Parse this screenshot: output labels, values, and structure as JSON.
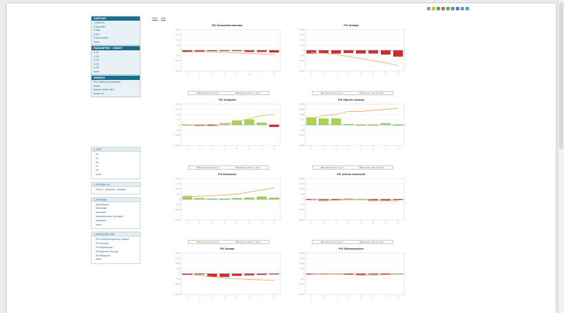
{
  "breadcrumb": [
    "stat",
    "ath"
  ],
  "sidebar": {
    "panels": [
      {
        "title": "SUPPORT",
        "items": [
          "1.Intensiv",
          "2.Spezifikt",
          "3.Test",
          "4.HEI",
          "5.Kennzahlen",
          "more"
        ]
      },
      {
        "title": "PARAMETER - CREDIT",
        "items": [
          "4_01",
          "4_02",
          "4_03",
          "4_04",
          "4_05",
          "more"
        ]
      },
      {
        "title": "MENGES",
        "items": [
          "PIV Liabilities prozentum",
          "Kredit",
          "Kapital anteil reg E",
          "Kredit Fin"
        ]
      }
    ],
    "filters": [
      {
        "title": "4_VISIT",
        "items": [
          "01",
          "02",
          "03",
          "04",
          "05",
          "more"
        ]
      },
      {
        "title": "4_SPICNAR_09",
        "items": [
          "201(2) : Schindler, Sanierer"
        ]
      },
      {
        "title": "4_SPEGAND",
        "items": [
          "Interfliessen",
          "Verkraege",
          "Anneigen",
          "Leistelekunden Anneigen",
          "Sanderes",
          "more"
        ]
      },
      {
        "title": "4_KATEGORIE_UNP",
        "items": [
          "PIV Umsatzsteigerung Gesamt",
          "PIV Umzugs",
          "PIV Ableitungen",
          "PIV Eigenes Umzugs",
          "PIV Retoumer",
          "more"
        ]
      }
    ]
  },
  "legend": {
    "series_a": "Kapital anteil reg E",
    "series_b": "Kapital anteil Fin reg E"
  },
  "colors": {
    "bar_neg": "#d42a2a",
    "bar_pos": "#a8d84a",
    "line": "#f0b070",
    "zero": "#5b8fa8",
    "panel_title": "#1a6b8f"
  },
  "chart_data": [
    {
      "type": "bar",
      "title": "PIV Kennzahlenumsatze",
      "ylim": [
        -2000,
        2000
      ],
      "yticks": [
        "2000",
        "1500",
        "1000",
        "500",
        "0",
        "-500",
        "-1000",
        "-2000"
      ],
      "xticks": [
        "1",
        "2",
        "3",
        "4",
        "5",
        "6",
        "7",
        "8"
      ],
      "series": [
        {
          "name": "Kapital anteil reg E",
          "values": [
            -150,
            -100,
            -50,
            -50,
            -50,
            -150,
            -150,
            -200
          ]
        },
        {
          "name": "Kapital anteil Fin reg E",
          "values": [
            -150,
            -150,
            -150,
            -200,
            -250,
            -300,
            -350,
            -400
          ]
        }
      ]
    },
    {
      "type": "bar",
      "title": "PIV Umlage",
      "ylim": [
        -2000,
        2000
      ],
      "yticks": [
        "2000",
        "1500",
        "1000",
        "500",
        "0",
        "-500",
        "-1000",
        "-2000"
      ],
      "xticks": [
        "1",
        "2",
        "3",
        "4",
        "5",
        "6",
        "7",
        "8"
      ],
      "series": [
        {
          "name": "Kapital anteil reg E",
          "values": [
            -300,
            -250,
            -300,
            -250,
            -300,
            -300,
            -400,
            -600
          ]
        },
        {
          "name": "Kapital anteil Fin reg E",
          "values": [
            -200,
            -300,
            -400,
            -600,
            -800,
            -1000,
            -1200,
            -1500
          ]
        }
      ]
    },
    {
      "type": "bar",
      "title": "PIV Umlagefo",
      "ylim": [
        -2000,
        2000
      ],
      "yticks": [
        "2000",
        "1500",
        "1000",
        "500",
        "0",
        "-500",
        "-1000",
        "-2000"
      ],
      "xticks": [
        "1",
        "2",
        "3",
        "4",
        "5",
        "6",
        "7",
        "8"
      ],
      "series": [
        {
          "name": "Kapital anteil reg E",
          "values": [
            0,
            -100,
            -100,
            150,
            400,
            500,
            200,
            -200
          ]
        },
        {
          "name": "Kapital anteil Fin reg E",
          "values": [
            0,
            -50,
            -100,
            50,
            300,
            600,
            900,
            1000
          ]
        }
      ]
    },
    {
      "type": "bar",
      "title": "PIV Eigenes Umzugs",
      "ylim": [
        -2000,
        2000
      ],
      "yticks": [
        "2000",
        "1500",
        "1000",
        "500",
        "0",
        "-500",
        "-1000",
        "-2000"
      ],
      "xticks": [
        "1",
        "2",
        "3",
        "4",
        "5",
        "6",
        "7",
        "8"
      ],
      "series": [
        {
          "name": "Kapital anteil reg E",
          "values": [
            700,
            600,
            600,
            50,
            0,
            0,
            150,
            0
          ]
        },
        {
          "name": "Kapital anteil Fin reg E",
          "values": [
            600,
            900,
            1000,
            1300,
            1300,
            1400,
            1500,
            1600
          ]
        }
      ]
    },
    {
      "type": "bar",
      "title": "PIV Retoumen",
      "ylim": [
        -2000,
        2000
      ],
      "yticks": [
        "2000",
        "1500",
        "1000",
        "500",
        "0",
        "-500",
        "-1000",
        "-2000"
      ],
      "xticks": [
        "1",
        "2",
        "3",
        "4",
        "5",
        "6",
        "7",
        "8"
      ],
      "series": [
        {
          "name": "Kapital anteil reg E",
          "values": [
            300,
            100,
            50,
            50,
            100,
            150,
            250,
            150
          ]
        },
        {
          "name": "Kapital anteil Fin reg E",
          "values": [
            200,
            300,
            350,
            400,
            500,
            700,
            900,
            1100
          ]
        }
      ]
    },
    {
      "type": "bar",
      "title": "PIV Interne Sanierunit",
      "ylim": [
        -2000,
        2000
      ],
      "yticks": [
        "2000",
        "1500",
        "1000",
        "500",
        "0",
        "-500",
        "-1000",
        "-2000"
      ],
      "xticks": [
        "1",
        "2",
        "3",
        "4",
        "5",
        "6",
        "7",
        "8"
      ],
      "series": [
        {
          "name": "Kapital anteil reg E",
          "values": [
            -50,
            -150,
            -50,
            50,
            0,
            -150,
            -100,
            -50
          ]
        },
        {
          "name": "Kapital anteil Fin reg E",
          "values": [
            -50,
            -100,
            -100,
            -50,
            -50,
            -100,
            -150,
            -150
          ]
        }
      ]
    },
    {
      "type": "bar",
      "title": "PIV Ansage",
      "ylim": [
        -2000,
        2000
      ],
      "yticks": [
        "2000",
        "1500",
        "1000",
        "500",
        "0",
        "-500",
        "-1000",
        "-2000"
      ],
      "xticks": [
        "1",
        "2",
        "3",
        "4",
        "5",
        "6",
        "7",
        "8"
      ],
      "series": [
        {
          "name": "Kapital anteil reg E",
          "values": [
            -100,
            -50,
            -300,
            -300,
            -200,
            -150,
            -100,
            -50
          ]
        },
        {
          "name": "Kapital anteil Fin reg E",
          "values": [
            -100,
            -150,
            -300,
            -400,
            -500,
            -550,
            -600,
            -650
          ]
        }
      ]
    },
    {
      "type": "bar",
      "title": "PIV Diskrepanzlane",
      "ylim": [
        -2000,
        2000
      ],
      "yticks": [
        "2000",
        "1500",
        "1000",
        "500",
        "0",
        "-500",
        "-1000",
        "-2000"
      ],
      "xticks": [
        "1",
        "2",
        "3",
        "4",
        "5",
        "6",
        "7",
        "8"
      ],
      "series": [
        {
          "name": "Kapital anteil reg E",
          "values": [
            -50,
            -50,
            0,
            -50,
            -100,
            -50,
            -50,
            0
          ]
        },
        {
          "name": "Kapital anteil Fin reg E",
          "values": [
            -50,
            -50,
            -50,
            -100,
            -150,
            -150,
            -100,
            -50
          ]
        }
      ]
    }
  ]
}
